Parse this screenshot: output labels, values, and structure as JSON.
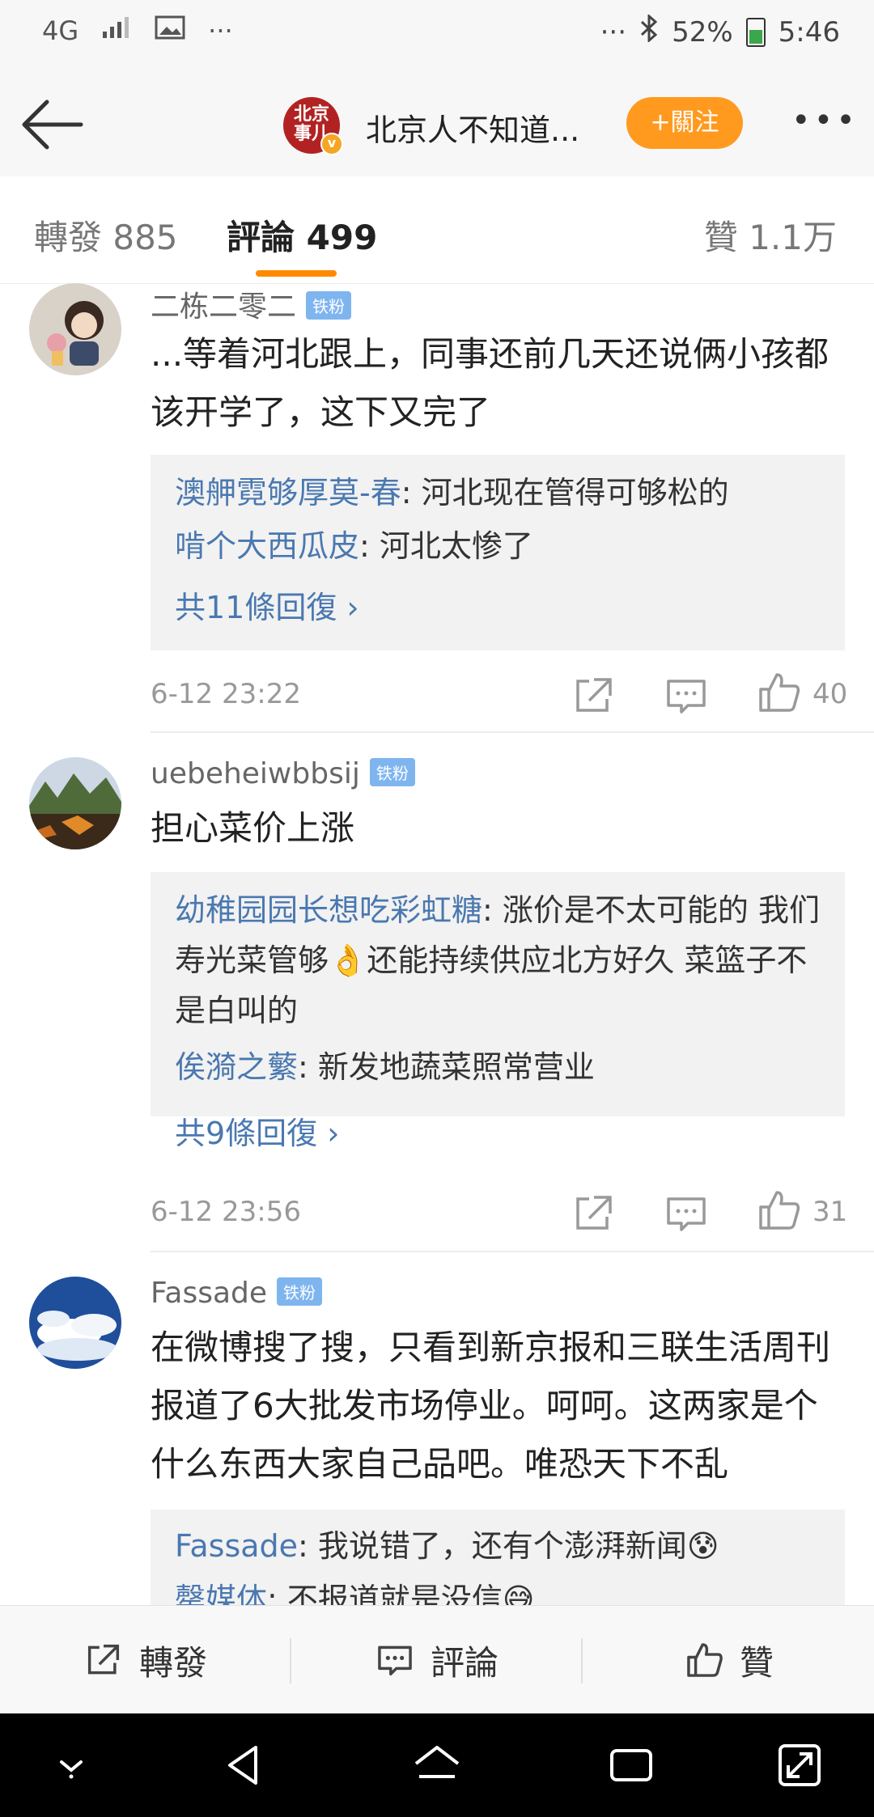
{
  "status_bar": {
    "network": "4G",
    "overflow_left": "···",
    "overflow_right": "···",
    "battery": "52%",
    "time": "5:46"
  },
  "header": {
    "account_logo_text": "北京事儿",
    "title": "北京人不知道...",
    "follow_label": "+關注",
    "more_label": "•••"
  },
  "tabs": {
    "repost": "轉發 885",
    "comments": "評論 499",
    "likes": "贊 1.1万"
  },
  "fan_badge": "铁粉",
  "comments": [
    {
      "user": "二栋二零二",
      "text": "...等着河北跟上，同事还前几天还说俩小孩都该开学了，这下又完了",
      "replies": [
        {
          "user": "澳舺霓够厚莫-春",
          "text": ": 河北现在管得可够松的"
        },
        {
          "user": "啃个大西瓜皮",
          "text": ": 河北太惨了"
        }
      ],
      "more_replies": "共11條回復 ›",
      "time": "6-12 23:22",
      "likes": "40"
    },
    {
      "user": "uebeheiwbbsij",
      "text": "担心菜价上涨",
      "replies": [
        {
          "user": "幼稚园园长想吃彩虹糖",
          "text": ": 涨价是不太可能的  我们寿光菜管够👌还能持续供应北方好久  菜篮子不是白叫的"
        },
        {
          "user": "俟漪之蘩",
          "text": ": 新发地蔬菜照常营业"
        }
      ],
      "more_replies": "共9條回復 ›",
      "time": "6-12 23:56",
      "likes": "31"
    },
    {
      "user": "Fassade",
      "text": "在微博搜了搜，只看到新京报和三联生活周刊报道了6大批发市场停业。呵呵。这两家是个什么东西大家自己品吧。唯恐天下不乱",
      "replies": [
        {
          "user": "Fassade",
          "text": ": 我说错了，还有个澎湃新闻😰"
        },
        {
          "user": "罄媒体",
          "text": ": 不报道就是没信😅"
        }
      ]
    }
  ],
  "toolbar": {
    "repost": "轉發",
    "comment": "評論",
    "like": "贊"
  },
  "colors": {
    "accent_orange": "#ff9a1f",
    "link_blue": "#4a78b0",
    "badge_blue": "#7fb5ef"
  }
}
